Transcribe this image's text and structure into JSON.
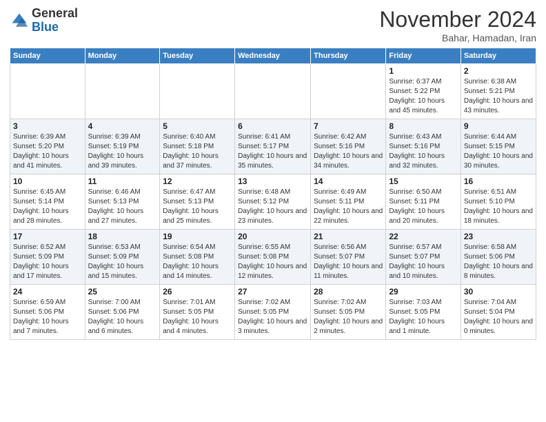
{
  "logo": {
    "general": "General",
    "blue": "Blue"
  },
  "header": {
    "month": "November 2024",
    "location": "Bahar, Hamadan, Iran"
  },
  "weekdays": [
    "Sunday",
    "Monday",
    "Tuesday",
    "Wednesday",
    "Thursday",
    "Friday",
    "Saturday"
  ],
  "weeks": [
    [
      {
        "day": "",
        "info": ""
      },
      {
        "day": "",
        "info": ""
      },
      {
        "day": "",
        "info": ""
      },
      {
        "day": "",
        "info": ""
      },
      {
        "day": "",
        "info": ""
      },
      {
        "day": "1",
        "info": "Sunrise: 6:37 AM\nSunset: 5:22 PM\nDaylight: 10 hours and 45 minutes."
      },
      {
        "day": "2",
        "info": "Sunrise: 6:38 AM\nSunset: 5:21 PM\nDaylight: 10 hours and 43 minutes."
      }
    ],
    [
      {
        "day": "3",
        "info": "Sunrise: 6:39 AM\nSunset: 5:20 PM\nDaylight: 10 hours and 41 minutes."
      },
      {
        "day": "4",
        "info": "Sunrise: 6:39 AM\nSunset: 5:19 PM\nDaylight: 10 hours and 39 minutes."
      },
      {
        "day": "5",
        "info": "Sunrise: 6:40 AM\nSunset: 5:18 PM\nDaylight: 10 hours and 37 minutes."
      },
      {
        "day": "6",
        "info": "Sunrise: 6:41 AM\nSunset: 5:17 PM\nDaylight: 10 hours and 35 minutes."
      },
      {
        "day": "7",
        "info": "Sunrise: 6:42 AM\nSunset: 5:16 PM\nDaylight: 10 hours and 34 minutes."
      },
      {
        "day": "8",
        "info": "Sunrise: 6:43 AM\nSunset: 5:16 PM\nDaylight: 10 hours and 32 minutes."
      },
      {
        "day": "9",
        "info": "Sunrise: 6:44 AM\nSunset: 5:15 PM\nDaylight: 10 hours and 30 minutes."
      }
    ],
    [
      {
        "day": "10",
        "info": "Sunrise: 6:45 AM\nSunset: 5:14 PM\nDaylight: 10 hours and 28 minutes."
      },
      {
        "day": "11",
        "info": "Sunrise: 6:46 AM\nSunset: 5:13 PM\nDaylight: 10 hours and 27 minutes."
      },
      {
        "day": "12",
        "info": "Sunrise: 6:47 AM\nSunset: 5:13 PM\nDaylight: 10 hours and 25 minutes."
      },
      {
        "day": "13",
        "info": "Sunrise: 6:48 AM\nSunset: 5:12 PM\nDaylight: 10 hours and 23 minutes."
      },
      {
        "day": "14",
        "info": "Sunrise: 6:49 AM\nSunset: 5:11 PM\nDaylight: 10 hours and 22 minutes."
      },
      {
        "day": "15",
        "info": "Sunrise: 6:50 AM\nSunset: 5:11 PM\nDaylight: 10 hours and 20 minutes."
      },
      {
        "day": "16",
        "info": "Sunrise: 6:51 AM\nSunset: 5:10 PM\nDaylight: 10 hours and 18 minutes."
      }
    ],
    [
      {
        "day": "17",
        "info": "Sunrise: 6:52 AM\nSunset: 5:09 PM\nDaylight: 10 hours and 17 minutes."
      },
      {
        "day": "18",
        "info": "Sunrise: 6:53 AM\nSunset: 5:09 PM\nDaylight: 10 hours and 15 minutes."
      },
      {
        "day": "19",
        "info": "Sunrise: 6:54 AM\nSunset: 5:08 PM\nDaylight: 10 hours and 14 minutes."
      },
      {
        "day": "20",
        "info": "Sunrise: 6:55 AM\nSunset: 5:08 PM\nDaylight: 10 hours and 12 minutes."
      },
      {
        "day": "21",
        "info": "Sunrise: 6:56 AM\nSunset: 5:07 PM\nDaylight: 10 hours and 11 minutes."
      },
      {
        "day": "22",
        "info": "Sunrise: 6:57 AM\nSunset: 5:07 PM\nDaylight: 10 hours and 10 minutes."
      },
      {
        "day": "23",
        "info": "Sunrise: 6:58 AM\nSunset: 5:06 PM\nDaylight: 10 hours and 8 minutes."
      }
    ],
    [
      {
        "day": "24",
        "info": "Sunrise: 6:59 AM\nSunset: 5:06 PM\nDaylight: 10 hours and 7 minutes."
      },
      {
        "day": "25",
        "info": "Sunrise: 7:00 AM\nSunset: 5:06 PM\nDaylight: 10 hours and 6 minutes."
      },
      {
        "day": "26",
        "info": "Sunrise: 7:01 AM\nSunset: 5:05 PM\nDaylight: 10 hours and 4 minutes."
      },
      {
        "day": "27",
        "info": "Sunrise: 7:02 AM\nSunset: 5:05 PM\nDaylight: 10 hours and 3 minutes."
      },
      {
        "day": "28",
        "info": "Sunrise: 7:02 AM\nSunset: 5:05 PM\nDaylight: 10 hours and 2 minutes."
      },
      {
        "day": "29",
        "info": "Sunrise: 7:03 AM\nSunset: 5:05 PM\nDaylight: 10 hours and 1 minute."
      },
      {
        "day": "30",
        "info": "Sunrise: 7:04 AM\nSunset: 5:04 PM\nDaylight: 10 hours and 0 minutes."
      }
    ]
  ]
}
